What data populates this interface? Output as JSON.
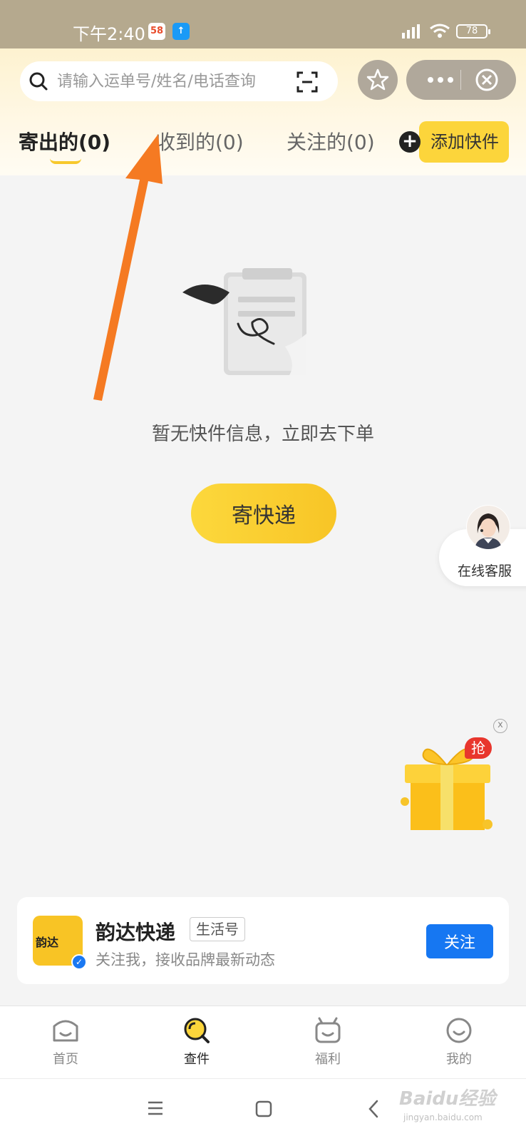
{
  "status_bar": {
    "time": "下午2:40",
    "app_badge_1": "58",
    "app_badge_2": "↑",
    "battery": "78"
  },
  "header": {
    "search_placeholder": "请输入运单号/姓名/电话查询",
    "icons": [
      "search-icon",
      "scan-icon",
      "star-icon",
      "more-icon",
      "close-icon"
    ]
  },
  "tabs": [
    {
      "label": "寄出的(0)",
      "active": true
    },
    {
      "label": "收到的(0)",
      "active": false
    },
    {
      "label": "关注的(0)",
      "active": false
    }
  ],
  "add_button": {
    "icon": "+",
    "label": "添加快件"
  },
  "empty_state": {
    "message": "暂无快件信息，立即去下单",
    "button_label": "寄快递"
  },
  "customer_service": {
    "label": "在线客服"
  },
  "gift": {
    "badge": "抢",
    "close": "x"
  },
  "brand_card": {
    "logo_text": "韵达",
    "name": "韵达快递",
    "tag": "生活号",
    "description": "关注我，接收品牌最新动态",
    "follow_label": "关注"
  },
  "bottom_nav": [
    {
      "label": "首页",
      "active": false
    },
    {
      "label": "查件",
      "active": true
    },
    {
      "label": "福利",
      "active": false
    },
    {
      "label": "我的",
      "active": false
    }
  ],
  "watermark": {
    "text": "Baidu经验",
    "sub": "jingyan.baidu.com"
  },
  "colors": {
    "accent_yellow": "#fcd53b",
    "status_bar": "#b5a98e",
    "follow_blue": "#1677f2",
    "arrow_orange": "#f57a22"
  }
}
